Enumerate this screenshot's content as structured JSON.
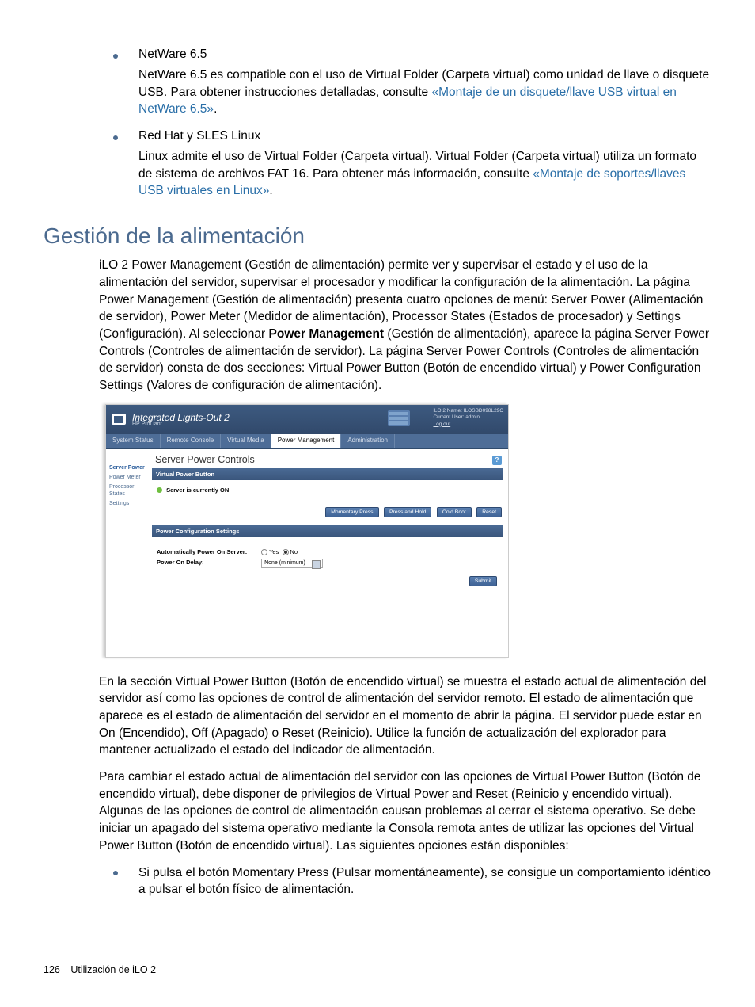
{
  "bullets_top": [
    {
      "title": "NetWare 6.5",
      "para_pre": "NetWare 6.5 es compatible con el uso de Virtual Folder (Carpeta virtual) como unidad de llave o disquete USB. Para obtener instrucciones detalladas, consulte ",
      "link": "«Montaje de un disquete/llave USB virtual en NetWare 6.5»",
      "para_post": "."
    },
    {
      "title": "Red Hat y SLES Linux",
      "para_pre": "Linux admite el uso de Virtual Folder (Carpeta virtual). Virtual Folder (Carpeta virtual) utiliza un formato de sistema de archivos FAT 16. Para obtener más información, consulte ",
      "link": "«Montaje de soportes/llaves USB virtuales en Linux»",
      "para_post": "."
    }
  ],
  "heading": "Gestión de la alimentación",
  "para1_pre": "iLO 2 Power Management (Gestión de alimentación) permite ver y supervisar el estado y el uso de la alimentación del servidor, supervisar el procesador y modificar la configuración de la alimentación. La página Power Management (Gestión de alimentación) presenta cuatro opciones de menú: Server Power (Alimentación de servidor), Power Meter (Medidor de alimentación), Processor States (Estados de procesador) y Settings (Configuración). Al seleccionar ",
  "para1_bold": "Power Management ",
  "para1_post": " (Gestión de alimentación), aparece la página Server Power Controls (Controles de alimentación de servidor). La página Server Power Controls (Controles de alimentación de servidor) consta de dos secciones: Virtual Power Button (Botón de encendido virtual) y Power Configuration Settings (Valores de configuración de alimentación).",
  "ilo": {
    "title": "Integrated Lights-Out 2",
    "subtitle": "HP ProLiant",
    "meta_name": "iLO 2 Name: ILOSBD098L29C",
    "meta_user": "Current User: admin",
    "meta_logout": "Log out",
    "tabs": [
      "System Status",
      "Remote Console",
      "Virtual Media",
      "Power Management",
      "Administration"
    ],
    "active_tab": 3,
    "side": [
      "Server Power",
      "Power Meter",
      "Processor States",
      "Settings"
    ],
    "side_active": 0,
    "main_title": "Server Power Controls",
    "sect1": "Virtual Power Button",
    "status": "Server is currently ON",
    "btns": [
      "Momentary Press",
      "Press and Hold",
      "Cold Boot",
      "Reset"
    ],
    "sect2": "Power Configuration Settings",
    "cfg1_label": "Automatically Power On Server:",
    "cfg1_yes": "Yes",
    "cfg1_no": "No",
    "cfg2_label": "Power On Delay:",
    "cfg2_value": "None (minimum)",
    "submit": "Submit",
    "help": "?"
  },
  "para2": "En la sección Virtual Power Button (Botón de encendido virtual) se muestra el estado actual de alimentación del servidor así como las opciones de control de alimentación del servidor remoto. El estado de alimentación que aparece es el estado de alimentación del servidor en el momento de abrir la página. El servidor puede estar en On (Encendido), Off (Apagado) o Reset (Reinicio). Utilice la función de actualización del explorador para mantener actualizado el estado del indicador de alimentación.",
  "para3": "Para cambiar el estado actual de alimentación del servidor con las opciones de Virtual Power Button (Botón de encendido virtual), debe disponer de privilegios de Virtual Power and Reset (Reinicio y encendido virtual). Algunas de las opciones de control de alimentación causan problemas al cerrar el sistema operativo. Se debe iniciar un apagado del sistema operativo mediante la Consola remota antes de utilizar las opciones del Virtual Power Button (Botón de encendido virtual). Las siguientes opciones están disponibles:",
  "bullets_bottom": [
    {
      "text": "Si pulsa el botón Momentary Press (Pulsar momentáneamente), se consigue un comportamiento idéntico a pulsar el botón físico de alimentación."
    }
  ],
  "footer_page": "126",
  "footer_text": "Utilización de iLO 2"
}
